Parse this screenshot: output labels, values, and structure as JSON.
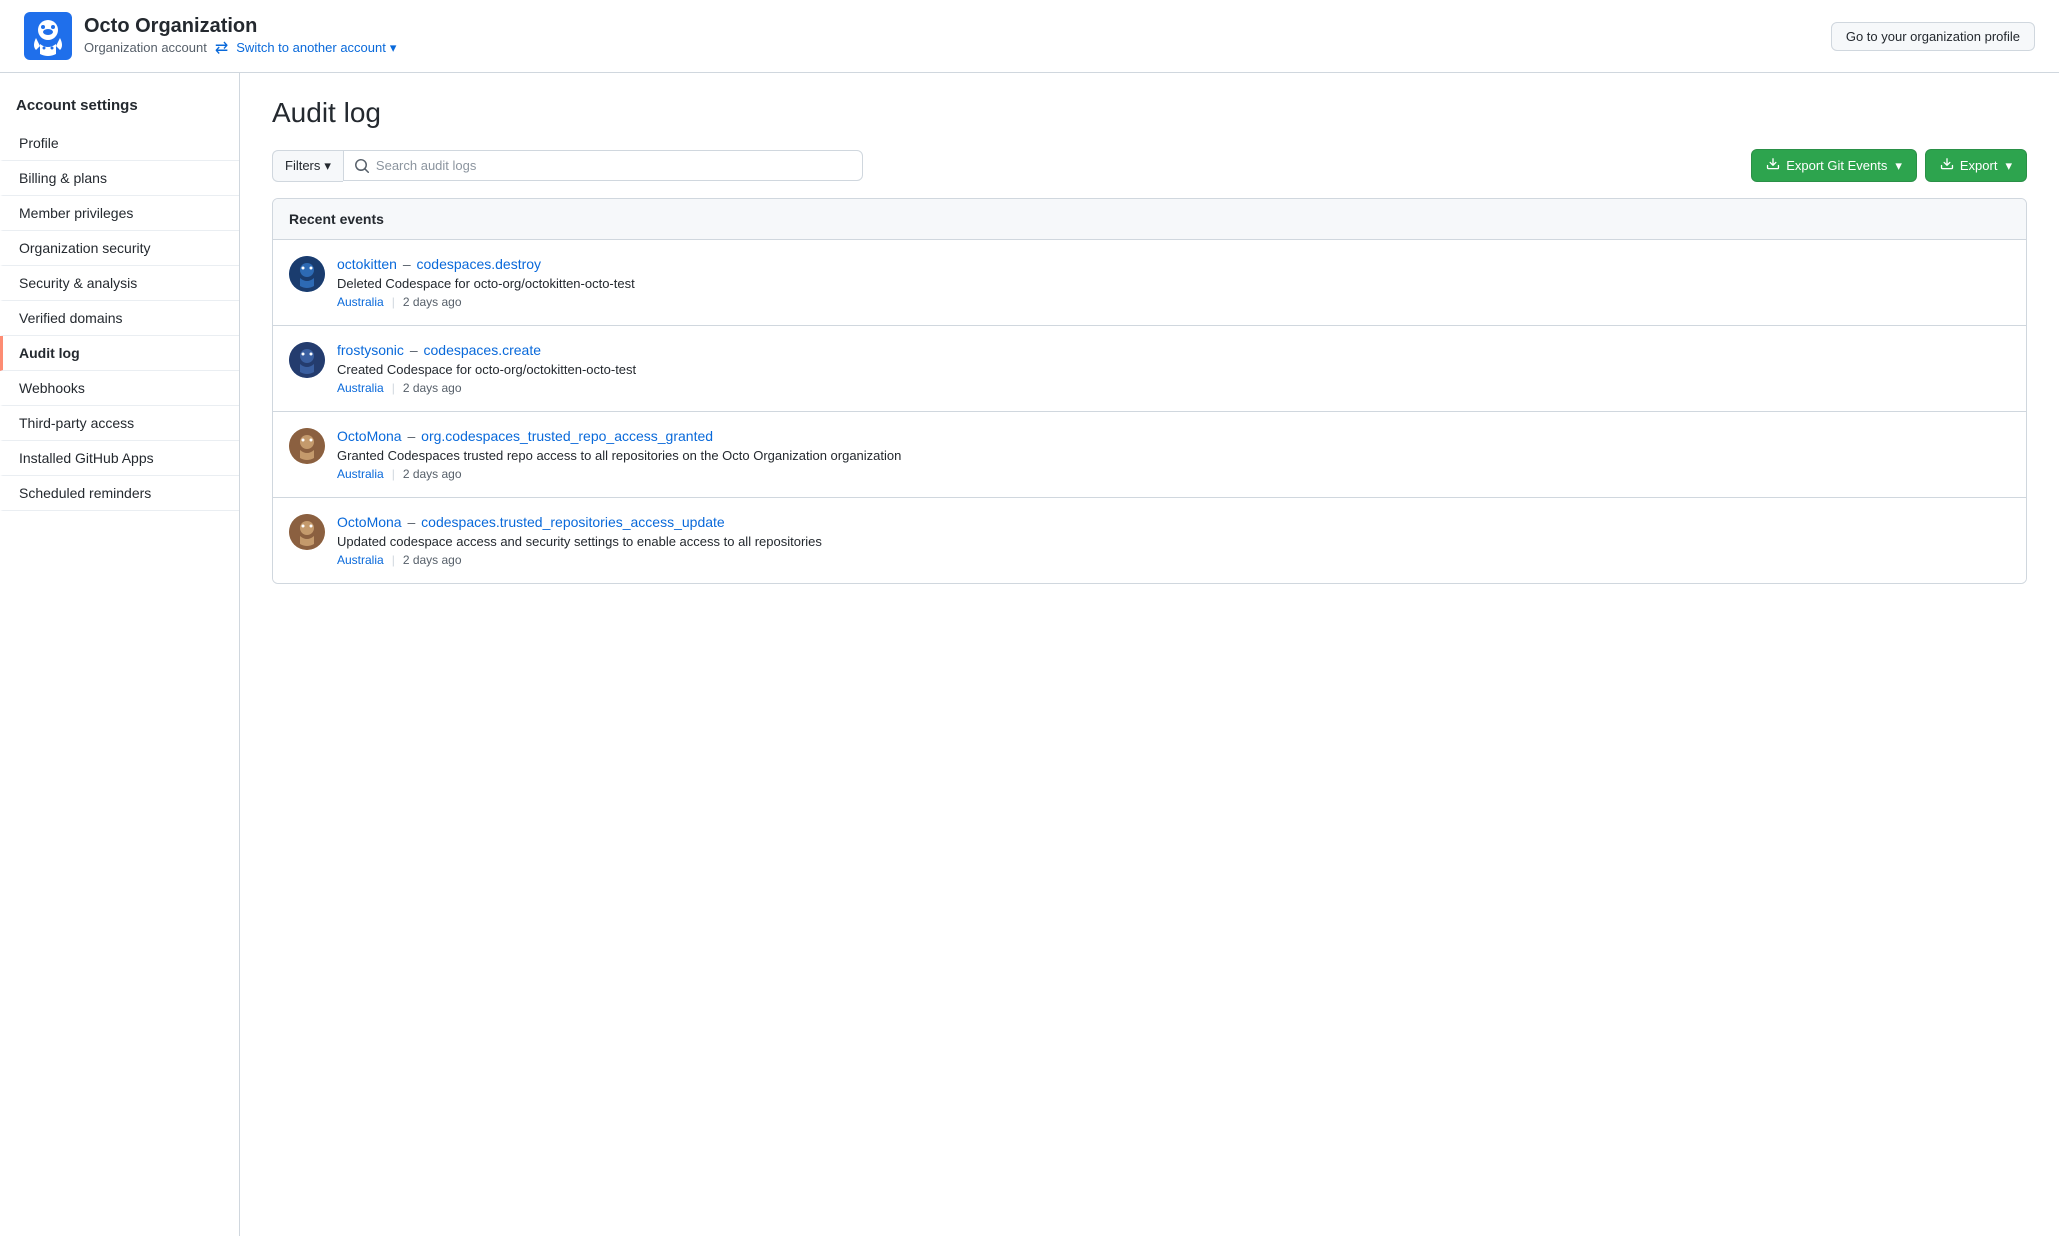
{
  "header": {
    "org_name": "Octo Organization",
    "org_type": "Organization account",
    "switch_account_label": "Switch to another account",
    "org_profile_btn": "Go to your organization profile"
  },
  "sidebar": {
    "heading": "Account settings",
    "items": [
      {
        "id": "profile",
        "label": "Profile",
        "active": false
      },
      {
        "id": "billing",
        "label": "Billing & plans",
        "active": false
      },
      {
        "id": "member-privileges",
        "label": "Member privileges",
        "active": false
      },
      {
        "id": "org-security",
        "label": "Organization security",
        "active": false
      },
      {
        "id": "security-analysis",
        "label": "Security & analysis",
        "active": false
      },
      {
        "id": "verified-domains",
        "label": "Verified domains",
        "active": false
      },
      {
        "id": "audit-log",
        "label": "Audit log",
        "active": true
      },
      {
        "id": "webhooks",
        "label": "Webhooks",
        "active": false
      },
      {
        "id": "third-party",
        "label": "Third-party access",
        "active": false
      },
      {
        "id": "github-apps",
        "label": "Installed GitHub Apps",
        "active": false
      },
      {
        "id": "scheduled-reminders",
        "label": "Scheduled reminders",
        "active": false
      }
    ]
  },
  "main": {
    "page_title": "Audit log",
    "filters_label": "Filters",
    "search_placeholder": "Search audit logs",
    "export_git_events_label": "Export Git Events",
    "export_label": "Export",
    "events_section_title": "Recent events",
    "events": [
      {
        "id": "event-1",
        "user": "octokitten",
        "action": "codespaces.destroy",
        "description": "Deleted Codespace for octo-org/octokitten-octo-test",
        "location": "Australia",
        "time": "2 days ago",
        "avatar_type": "octokitten"
      },
      {
        "id": "event-2",
        "user": "frostysonic",
        "action": "codespaces.create",
        "description": "Created Codespace for octo-org/octokitten-octo-test",
        "location": "Australia",
        "time": "2 days ago",
        "avatar_type": "frostysonic"
      },
      {
        "id": "event-3",
        "user": "OctoMona",
        "action": "org.codespaces_trusted_repo_access_granted",
        "description": "Granted Codespaces trusted repo access to all repositories on the Octo Organization organization",
        "location": "Australia",
        "time": "2 days ago",
        "avatar_type": "octomona"
      },
      {
        "id": "event-4",
        "user": "OctoMona",
        "action": "codespaces.trusted_repositories_access_update",
        "description": "Updated codespace access and security settings to enable access to all repositories",
        "location": "Australia",
        "time": "2 days ago",
        "avatar_type": "octomona"
      }
    ]
  },
  "colors": {
    "accent_green": "#2da44e",
    "accent_blue": "#0969da",
    "active_border": "#fd8c73"
  }
}
